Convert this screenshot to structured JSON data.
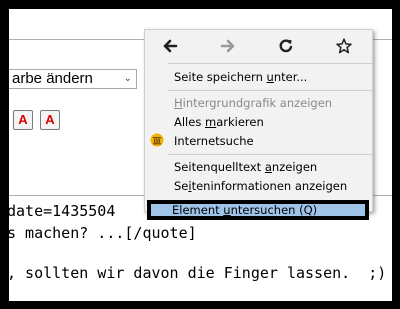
{
  "editor": {
    "color_select_value": "arbe ändern",
    "format_button_1_label": "A",
    "format_button_2_label": "A"
  },
  "post": {
    "line1": "date=1435504",
    "line2": "s machen? ...[/quote]",
    "line3": ", sollten wir davon die Finger lassen.  ;)"
  },
  "context_menu": {
    "back_icon": "arrow-left-icon",
    "forward_icon": "arrow-right-icon",
    "reload_icon": "reload-icon",
    "bookmark_icon": "star-icon",
    "items": [
      {
        "pre": "Seite speichern ",
        "acc": "u",
        "post": "nter...",
        "disabled": false
      },
      {
        "pre": "",
        "acc": "H",
        "post": "intergrundgrafik anzeigen",
        "disabled": true
      },
      {
        "pre": "Alles ",
        "acc": "m",
        "post": "arkieren",
        "disabled": false
      },
      {
        "pre": "Internetsuche",
        "acc": "",
        "post": "",
        "disabled": false,
        "icon": "search-engine-icon"
      },
      {
        "pre": "Seitenquelltext ",
        "acc": "a",
        "post": "nzeigen",
        "disabled": false
      },
      {
        "pre": "Se",
        "acc": "i",
        "post": "teninformationen anzeigen",
        "disabled": false
      }
    ],
    "highlighted_item": {
      "pre": "Element ",
      "acc": "u",
      "post": "ntersuchen (Q)"
    }
  },
  "colors": {
    "menu_bg": "#f2f2f2",
    "highlight_bg": "#9fc4e8",
    "format_button_text": "#dd0000",
    "frame_border": "#000000"
  }
}
